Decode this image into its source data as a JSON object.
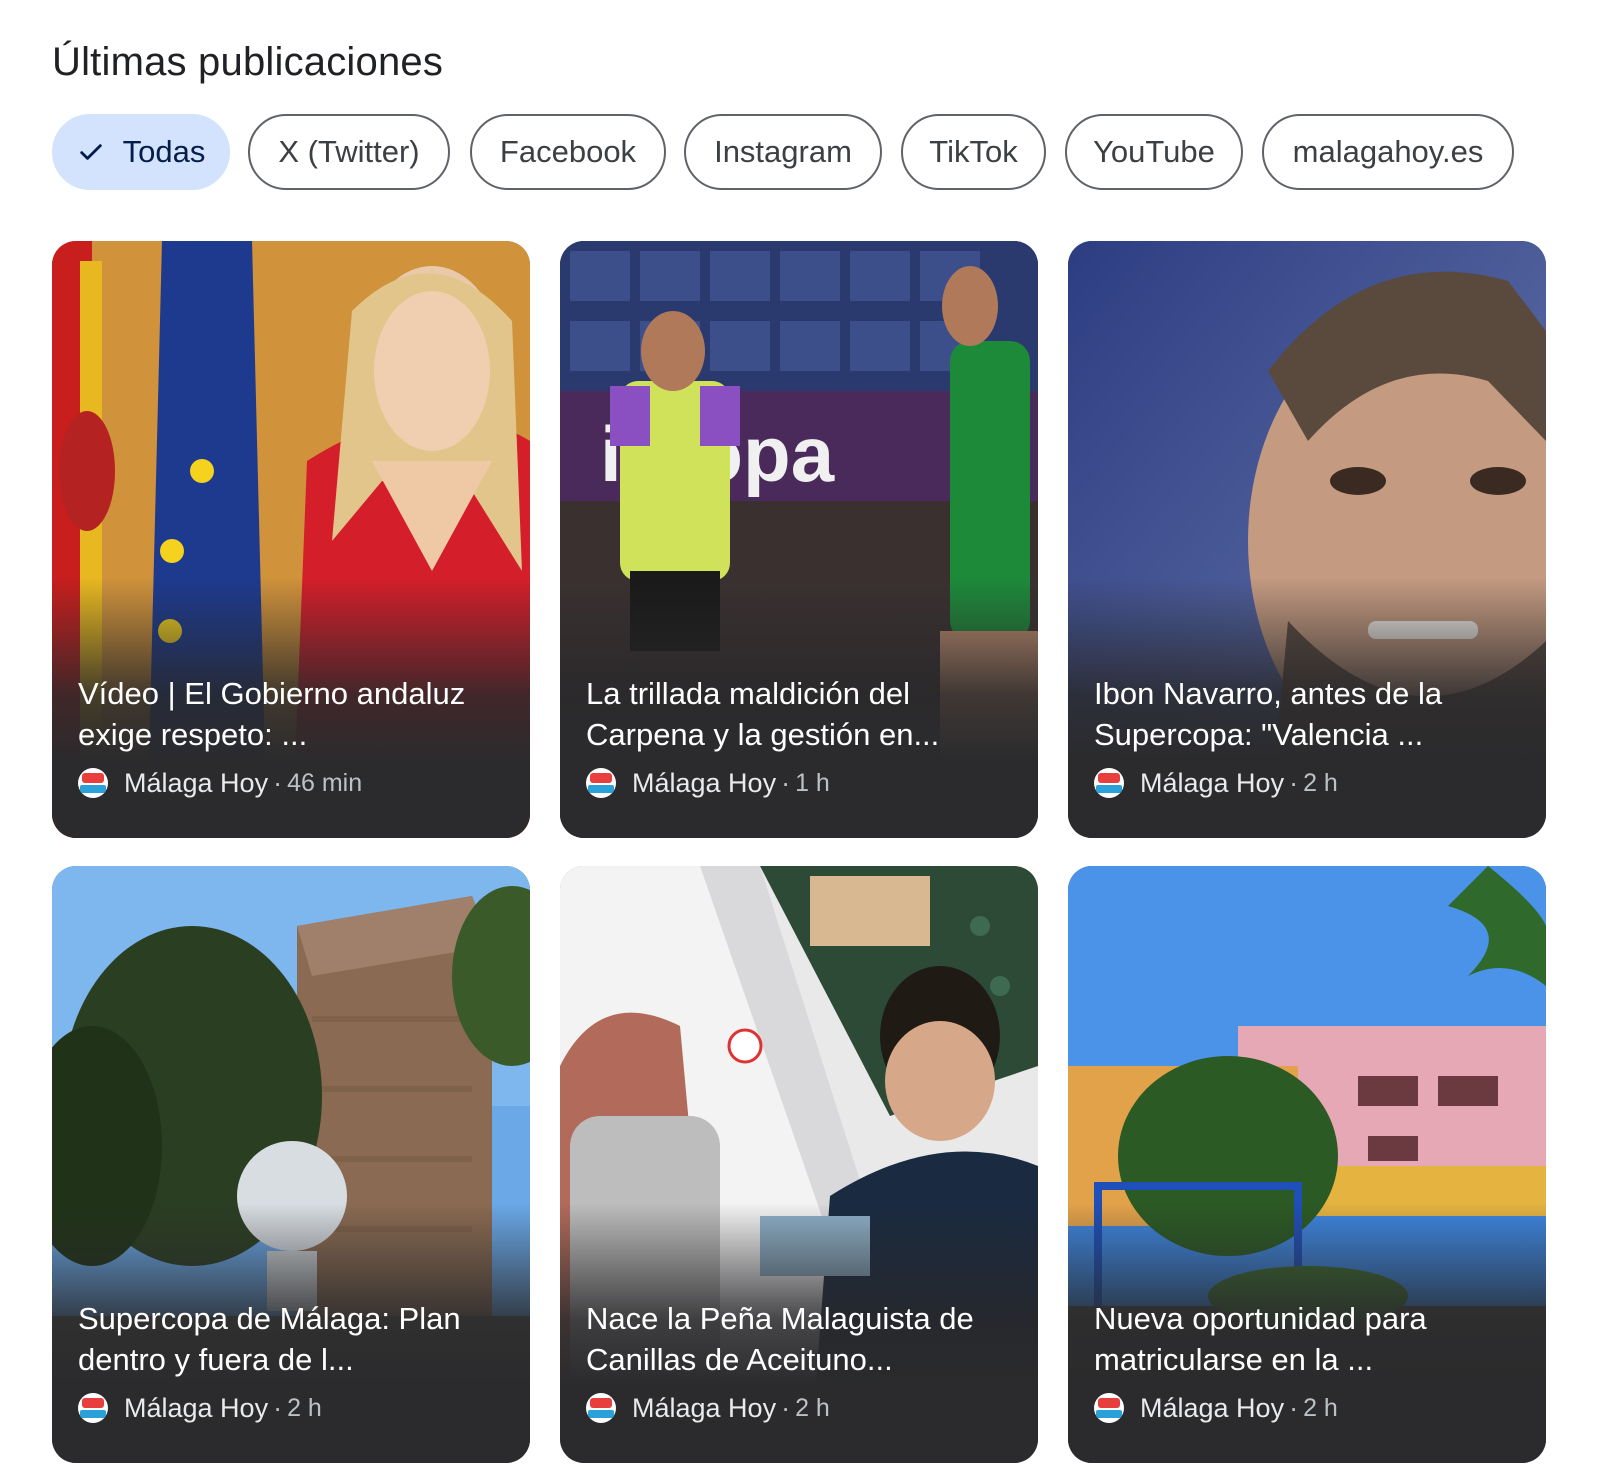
{
  "section": {
    "title": "Últimas publicaciones"
  },
  "filters": [
    {
      "label": "Todas",
      "selected": true
    },
    {
      "label": "X (Twitter)",
      "selected": false
    },
    {
      "label": "Facebook",
      "selected": false
    },
    {
      "label": "Instagram",
      "selected": false
    },
    {
      "label": "TikTok",
      "selected": false
    },
    {
      "label": "YouTube",
      "selected": false
    },
    {
      "label": "malagahoy.es",
      "selected": false
    }
  ],
  "cards": [
    {
      "headline": "Vídeo | El Gobierno andaluz exige respeto: ...",
      "source": "Málaga Hoy",
      "separator": "·",
      "time": "46 min"
    },
    {
      "headline": "La trillada maldición del Carpena y la gestión en...",
      "source": "Málaga Hoy",
      "separator": "·",
      "time": "1 h"
    },
    {
      "headline": "Ibon Navarro, antes de la Supercopa: \"Valencia ...",
      "source": "Málaga Hoy",
      "separator": "·",
      "time": "2 h"
    },
    {
      "headline": "Supercopa de Málaga: Plan dentro y fuera de l...",
      "source": "Málaga Hoy",
      "separator": "·",
      "time": "2 h"
    },
    {
      "headline": "Nace la Peña Malaguista de Canillas de Aceituno...",
      "source": "Málaga Hoy",
      "separator": "·",
      "time": "2 h"
    },
    {
      "headline": "Nueva oportunidad para matricularse en la ...",
      "source": "Málaga Hoy",
      "separator": "·",
      "time": "2 h"
    }
  ],
  "colors": {
    "chip_selected_bg": "#d3e3fd",
    "chip_border": "#5f6368",
    "card_bottom": "#2b2b2d"
  },
  "icons": {
    "chip_selected": "check-icon",
    "source": "malaga-hoy-logo-icon"
  }
}
